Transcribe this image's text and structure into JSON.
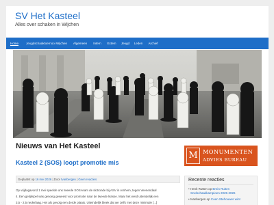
{
  "header": {
    "title": "SV Het Kasteel",
    "description": "Alles over schaken in Wijchen"
  },
  "nav": {
    "items": [
      {
        "label": "Home",
        "active": true
      },
      {
        "label": "Jeugdschaaktoernooi Wijchen"
      },
      {
        "label": "Algemeen"
      },
      {
        "label": "Intern"
      },
      {
        "label": "Extern"
      },
      {
        "label": "Jeugd"
      },
      {
        "label": "Leden"
      },
      {
        "label": "Archief"
      }
    ]
  },
  "banner": {
    "description": "Photo of giant outdoor chess pieces on a square"
  },
  "main": {
    "heading": "Nieuws van Het Kasteel",
    "post": {
      "title": "Kasteel 2 (SOS) loopt promotie mis",
      "meta": {
        "posted_label": "Geplaatst op",
        "date": "16 mei 2026",
        "by_label": "Door",
        "author": "tvanbergen",
        "separator": "|",
        "comments": "Geen reacties"
      },
      "excerpt_lines": [
        "Op vrijdagavond 1 mei speelde ons tweede SOS-team de slotronde bij ASV in Arnhem, tegen Veenendaal",
        "4. Een gelijkspel was genoeg geweest voor promotie naar de tweede klasse. Maar het werd uiteindelijk een",
        "3,5 - 2,5 nederlaag. Het als gevolg een derde plaats. Uiteindelijk bleek dat we zelfs met deze minimale [...]"
      ]
    }
  },
  "sidebar": {
    "ad": {
      "symbol": "M",
      "line1": "MONUMENTEN",
      "line2": "ADVIES BUREAU"
    },
    "recent": {
      "title": "Recente reacties",
      "on_label": "op",
      "items": [
        {
          "author": "Henk Rutten",
          "link_part1": "Brein Ruiten",
          "link_part2": "Snelschaakkampioen 2025-2026"
        },
        {
          "author": "tvanbergen",
          "link_part1": "Coen Stehouwer wint",
          "link_part2": ""
        }
      ]
    }
  },
  "colors": {
    "accent": "#1e6ec8",
    "nav_bg": "#1e6ec8",
    "ad_bg": "#d9541e",
    "page_bg": "#eeeeee"
  }
}
